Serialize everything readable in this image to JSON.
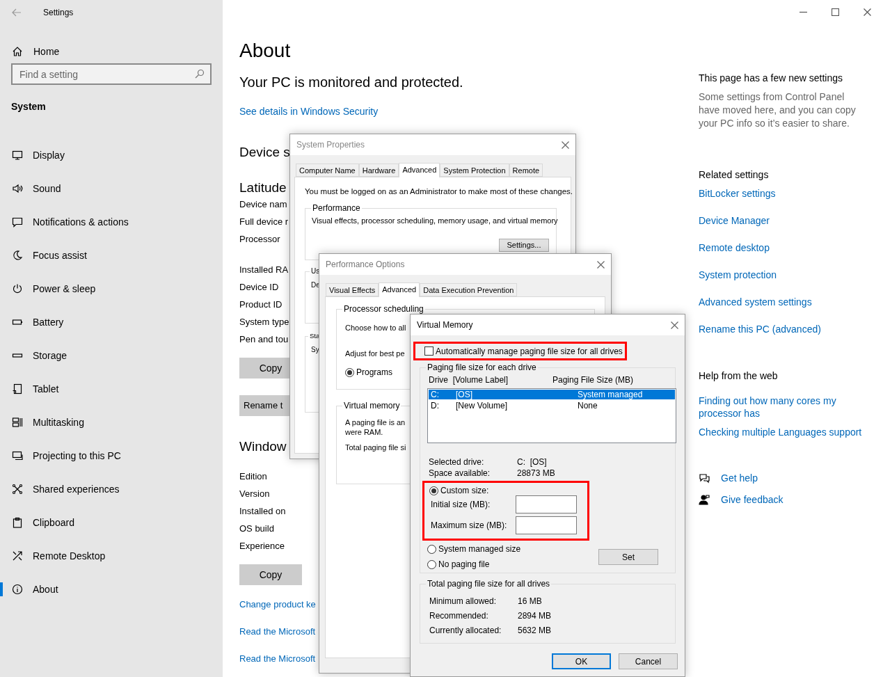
{
  "settings_window": {
    "title": "Settings",
    "sidebar": {
      "home": "Home",
      "search": {
        "placeholder": "Find a setting"
      },
      "section": "System",
      "items": [
        {
          "label": "Display",
          "selected": false
        },
        {
          "label": "Sound",
          "selected": false
        },
        {
          "label": "Notifications & actions",
          "selected": false
        },
        {
          "label": "Focus assist",
          "selected": false
        },
        {
          "label": "Power & sleep",
          "selected": false
        },
        {
          "label": "Battery",
          "selected": false
        },
        {
          "label": "Storage",
          "selected": false
        },
        {
          "label": "Tablet",
          "selected": false
        },
        {
          "label": "Multitasking",
          "selected": false
        },
        {
          "label": "Projecting to this PC",
          "selected": false
        },
        {
          "label": "Shared experiences",
          "selected": false
        },
        {
          "label": "Clipboard",
          "selected": false
        },
        {
          "label": "Remote Desktop",
          "selected": false
        },
        {
          "label": "About",
          "selected": true
        }
      ]
    },
    "main": {
      "title": "About",
      "security_status": "Your PC is monitored and protected.",
      "security_link": "See details in Windows Security",
      "device": {
        "heading": "Device s",
        "model": "Latitude",
        "row_groups": [
          [
            "Device nam",
            "Full device r",
            "Processor"
          ],
          [
            "Installed RA",
            "Device ID",
            "Product ID",
            "System type",
            "Pen and tou"
          ]
        ],
        "copy_button": "Copy",
        "rename_button": "Rename t"
      },
      "windows": {
        "heading": "Window",
        "rows": [
          "Edition",
          "Version",
          "Installed on",
          "OS build",
          "Experience"
        ],
        "copy_button": "Copy"
      },
      "links": [
        "Change product ke",
        "Read the Microsoft",
        "Read the Microsoft"
      ]
    },
    "aside": {
      "new_settings": {
        "title": "This page has a few new settings",
        "text": "Some settings from Control Panel have moved here, and you can copy your PC info so it’s easier to share."
      },
      "related": {
        "title": "Related settings",
        "links": [
          "BitLocker settings",
          "Device Manager",
          "Remote desktop",
          "System protection",
          "Advanced system settings",
          "Rename this PC (advanced)"
        ]
      },
      "help": {
        "title": "Help from the web",
        "links": [
          "Finding out how many cores my processor has",
          "Checking multiple Languages support"
        ]
      },
      "actions": [
        "Get help",
        "Give feedback"
      ]
    }
  },
  "system_properties": {
    "title": "System Properties",
    "tabs": [
      {
        "label": "Computer Name",
        "selected": false
      },
      {
        "label": "Hardware",
        "selected": false
      },
      {
        "label": "Advanced",
        "selected": true
      },
      {
        "label": "System Protection",
        "selected": false
      },
      {
        "label": "Remote",
        "selected": false
      }
    ],
    "notice": "You must be logged on as an Administrator to make most of these changes.",
    "performance": {
      "label": "Performance",
      "text": "Visual effects, processor scheduling, memory usage, and virtual memory",
      "button": "Settings..."
    },
    "user_profiles": {
      "label": "Us",
      "text": "De"
    },
    "startup": {
      "label": "Sta",
      "text": "Sy"
    }
  },
  "performance_options": {
    "title": "Performance Options",
    "tabs": [
      {
        "label": "Visual Effects",
        "selected": false
      },
      {
        "label": "Advanced",
        "selected": true
      },
      {
        "label": "Data Execution Prevention",
        "selected": false
      }
    ],
    "processor_scheduling": {
      "label": "Processor scheduling",
      "text": "Choose how to all",
      "adjust": "Adjust for best pe",
      "options": [
        {
          "label": "Programs",
          "selected": true
        }
      ]
    },
    "virtual_memory": {
      "label": "Virtual memory",
      "text": "A paging file is an",
      "text_2": "were RAM.",
      "total": "Total paging file si"
    }
  },
  "virtual_memory": {
    "title": "Virtual Memory",
    "auto_manage": {
      "label": "Automatically manage paging file size for all drives",
      "checked": false
    },
    "drives_group": {
      "label": "Paging file size for each drive",
      "columns": [
        "Drive  [Volume Label]",
        "Paging File Size (MB)"
      ],
      "drives": [
        {
          "drive": "C:",
          "volume": "[OS]",
          "size": "System managed",
          "selected": true
        },
        {
          "drive": "D:",
          "volume": "[New Volume]",
          "size": "None",
          "selected": false
        }
      ],
      "selected_drive": {
        "label": "Selected drive:",
        "value": "C:  [OS]"
      },
      "space_available": {
        "label": "Space available:",
        "value": "28873 MB"
      },
      "size_options": [
        {
          "kind": "custom",
          "label": "Custom size:",
          "selected": true
        },
        {
          "kind": "plain",
          "label": "System managed size",
          "selected": false
        },
        {
          "kind": "plain",
          "label": "No paging file",
          "selected": false
        }
      ],
      "initial_size": {
        "label": "Initial size (MB):"
      },
      "maximum_size": {
        "label": "Maximum size (MB):"
      },
      "set_button": "Set"
    },
    "totals": {
      "label": "Total paging file size for all drives",
      "rows": [
        {
          "label": "Minimum allowed:",
          "value": "16 MB"
        },
        {
          "label": "Recommended:",
          "value": "2894 MB"
        },
        {
          "label": "Currently allocated:",
          "value": "5632 MB"
        }
      ]
    },
    "buttons": [
      {
        "label": "OK",
        "default": true
      },
      {
        "label": "Cancel",
        "default": false
      }
    ]
  }
}
